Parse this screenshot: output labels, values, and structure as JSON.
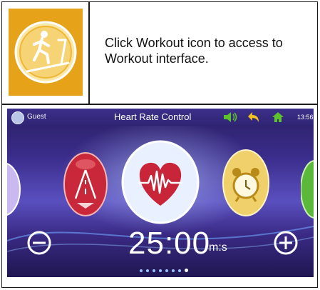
{
  "instruction": "Click Workout icon to access to Workout interface.",
  "icons": {
    "workout": "treadmill-runner-icon",
    "heart_rate": "heart-pulse-icon",
    "alarm": "alarm-clock-icon",
    "road": "road-icon",
    "minus": "minus-circle-icon",
    "plus": "plus-circle-icon",
    "volume": "volume-icon",
    "back": "back-arrow-icon",
    "home": "home-icon"
  },
  "device": {
    "user": "Guest",
    "title": "Heart Rate Control",
    "clock": "13:56",
    "time_value": "25:00",
    "time_unit": "m:s",
    "page_count": 8,
    "active_page": 8
  },
  "colors": {
    "icon_gold": "#e6a218",
    "status_green": "#5cc12a",
    "heart_red": "#c82638"
  }
}
